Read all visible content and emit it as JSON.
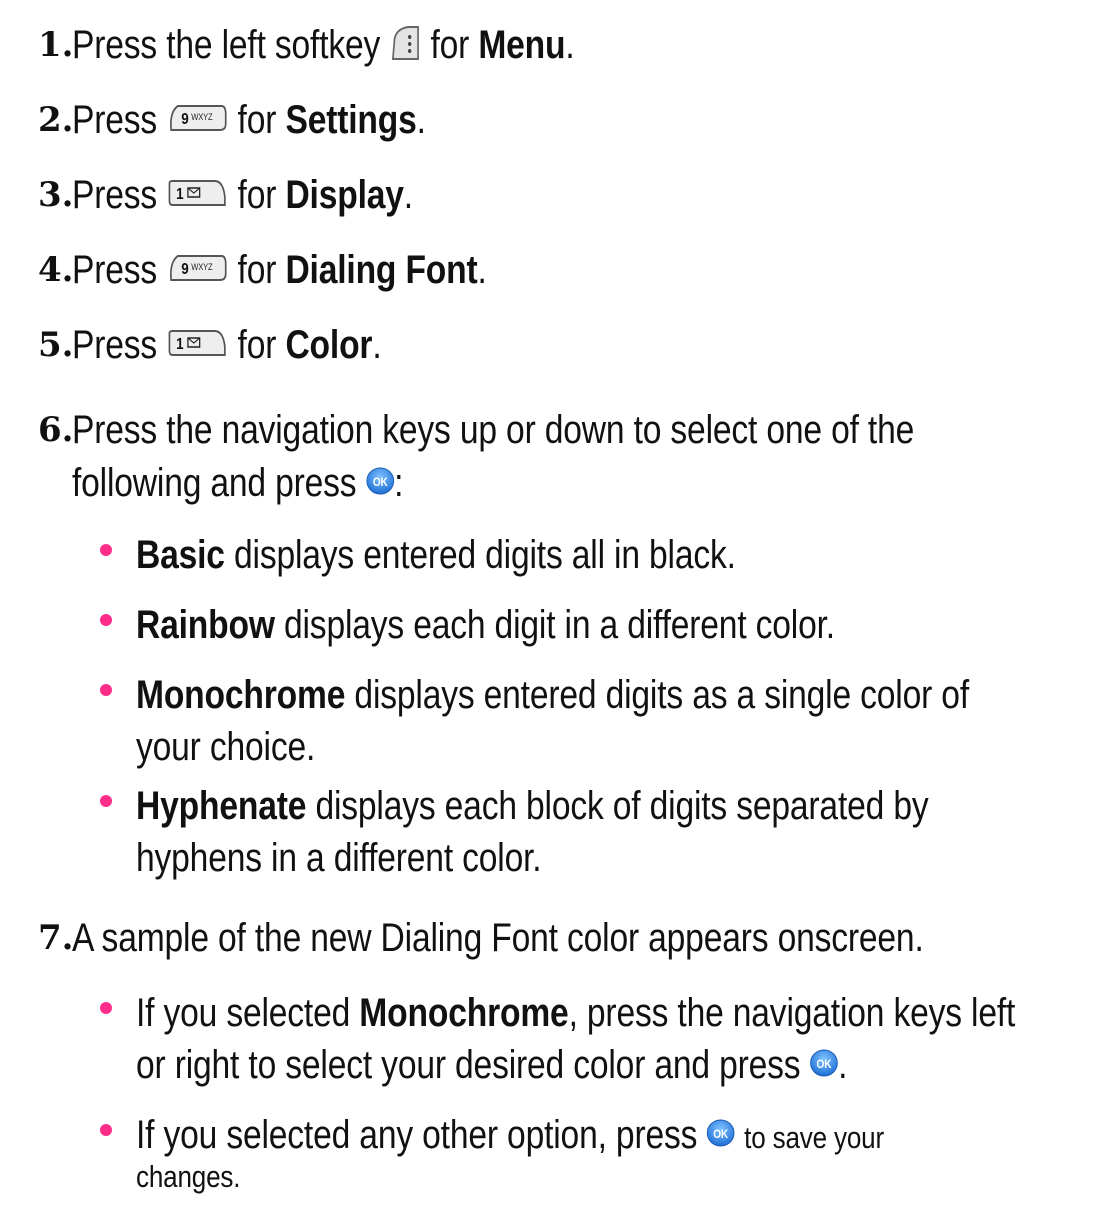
{
  "steps": [
    {
      "number": "1.",
      "pre": "Press the left softkey",
      "mid": "for",
      "bold": "Menu",
      "post": "."
    },
    {
      "number": "2.",
      "pre": "Press",
      "mid": "for",
      "bold": "Settings",
      "post": "."
    },
    {
      "number": "3.",
      "pre": "Press",
      "mid": "for",
      "bold": "Display",
      "post": "."
    },
    {
      "number": "4.",
      "pre": "Press",
      "mid": "for",
      "bold": "Dialing Font",
      "post": "."
    },
    {
      "number": "5.",
      "pre": "Press",
      "mid": "for",
      "bold": "Color",
      "post": "."
    },
    {
      "number": "6.",
      "line1": "Press the navigation keys up or down to select one of the",
      "line2_pre": "following and press",
      "line2_post": ":"
    },
    {
      "number": "7.",
      "line1": "A sample of the new Dialing Font color appears onscreen."
    }
  ],
  "options": [
    {
      "bold": "Basic",
      "text": " displays entered digits all in black."
    },
    {
      "bold": "Rainbow",
      "text": " displays each digit in a different color."
    },
    {
      "bold": "Monochrome",
      "text": " displays entered digits as a single color of",
      "text2": "your choice."
    },
    {
      "bold": "Hyphenate",
      "text": " displays each block of digits separated by",
      "text2": "hyphens in a different color."
    }
  ],
  "substeps": {
    "mono_pre": "If you selected ",
    "mono_bold": "Monochrome",
    "mono_post": ", press the navigation keys left",
    "mono_line2": "or right to select your desired color and press",
    "mono_end": ".",
    "other_pre": "If you selected any other option, press",
    "other_small": "to save your",
    "other_line2": "changes."
  },
  "keys": {
    "softkey": "left-softkey-icon",
    "nine": "9 WXYZ",
    "one": "1",
    "ok": "OK"
  },
  "colors": {
    "bullet": "#ff2d8a",
    "ok_blue": "#2a7fe0"
  }
}
